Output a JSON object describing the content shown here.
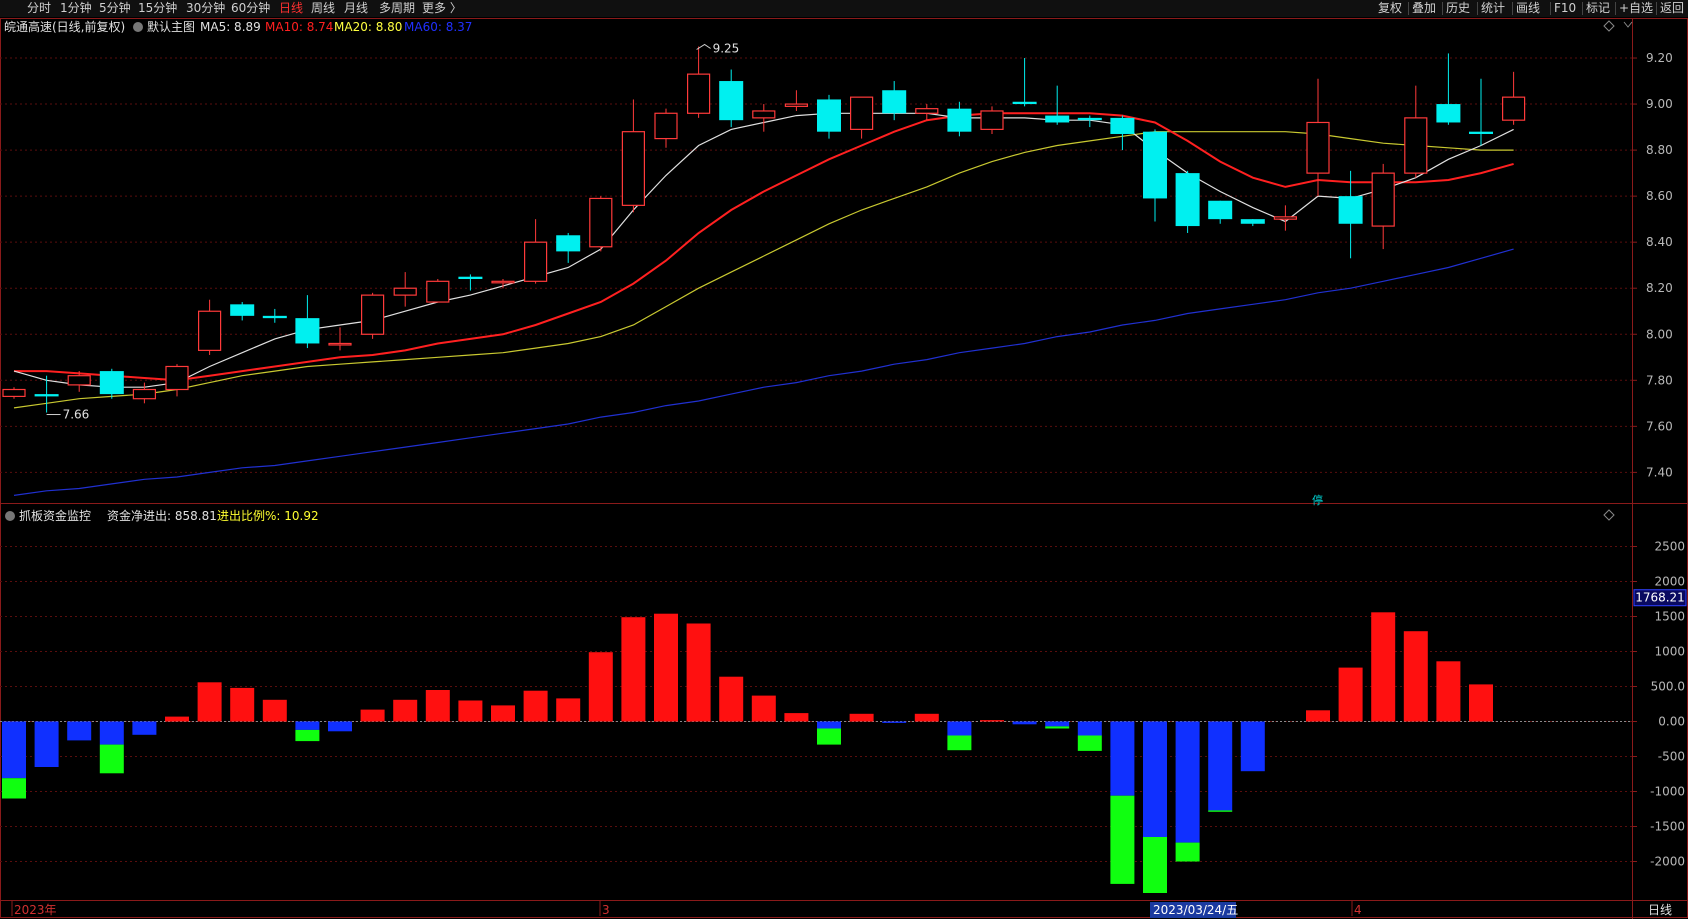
{
  "toolbar": {
    "periods": [
      "分时",
      "1分钟",
      "5分钟",
      "15分钟",
      "30分钟",
      "60分钟",
      "日线",
      "周线",
      "月线",
      "多周期",
      "更多 〉"
    ],
    "active_period": "日线",
    "actions": [
      "复权",
      "叠加",
      "历史",
      "统计",
      "画线",
      "F10",
      "标记",
      "+自选",
      "返回"
    ]
  },
  "main_panel": {
    "stock_title": "皖通高速(日线,前复权)",
    "template_label": "默认主图",
    "ma_labels": [
      {
        "text": "MA5: 8.89",
        "color": "#e0e0e0"
      },
      {
        "text": "MA10: 8.74",
        "color": "#ff2020"
      },
      {
        "text": "MA20: 8.80",
        "color": "#ffff40"
      },
      {
        "text": "MA60: 8.37",
        "color": "#2030ff"
      }
    ],
    "high_marker": "9.25",
    "low_marker": "7.66",
    "side_marker": "停"
  },
  "sub_panel": {
    "indicator_name": "抓板资金监控",
    "net_flow_label": "资金净进出: 858.81",
    "ratio_label": "进出比例%: 10.92",
    "current_value_tag": "1768.21"
  },
  "axis": {
    "dates": [
      "2023年",
      "3",
      "2023/03/24/五",
      "4"
    ],
    "period_label": "日线"
  },
  "chart_data": [
    {
      "type": "candlestick",
      "title": "皖通高速(日线,前复权)",
      "y_ticks": [
        "9.20",
        "9.00",
        "8.80",
        "8.60",
        "8.40",
        "8.20",
        "8.00",
        "7.80",
        "7.60",
        "7.40"
      ],
      "ylim": [
        7.28,
        9.3
      ],
      "candles": [
        {
          "o": 7.73,
          "c": 7.76,
          "h": 7.77,
          "l": 7.72
        },
        {
          "o": 7.74,
          "c": 7.73,
          "h": 7.82,
          "l": 7.66
        },
        {
          "o": 7.78,
          "c": 7.82,
          "h": 7.84,
          "l": 7.75
        },
        {
          "o": 7.84,
          "c": 7.74,
          "h": 7.85,
          "l": 7.72
        },
        {
          "o": 7.72,
          "c": 7.76,
          "h": 7.79,
          "l": 7.7
        },
        {
          "o": 7.76,
          "c": 7.86,
          "h": 7.87,
          "l": 7.73
        },
        {
          "o": 7.93,
          "c": 8.1,
          "h": 8.15,
          "l": 7.91
        },
        {
          "o": 8.13,
          "c": 8.08,
          "h": 8.14,
          "l": 8.06
        },
        {
          "o": 8.08,
          "c": 8.07,
          "h": 8.11,
          "l": 8.05
        },
        {
          "o": 8.07,
          "c": 7.96,
          "h": 8.17,
          "l": 7.94
        },
        {
          "o": 7.96,
          "c": 7.96,
          "h": 8.03,
          "l": 7.93
        },
        {
          "o": 8.0,
          "c": 8.17,
          "h": 8.18,
          "l": 7.98
        },
        {
          "o": 8.17,
          "c": 8.2,
          "h": 8.27,
          "l": 8.12
        },
        {
          "o": 8.14,
          "c": 8.23,
          "h": 8.24,
          "l": 8.14
        },
        {
          "o": 8.25,
          "c": 8.24,
          "h": 8.26,
          "l": 8.19
        },
        {
          "o": 8.23,
          "c": 8.23,
          "h": 8.24,
          "l": 8.2
        },
        {
          "o": 8.23,
          "c": 8.4,
          "h": 8.5,
          "l": 8.22
        },
        {
          "o": 8.43,
          "c": 8.36,
          "h": 8.44,
          "l": 8.31
        },
        {
          "o": 8.38,
          "c": 8.59,
          "h": 8.6,
          "l": 8.36
        },
        {
          "o": 8.56,
          "c": 8.88,
          "h": 9.02,
          "l": 8.53
        },
        {
          "o": 8.85,
          "c": 8.96,
          "h": 8.98,
          "l": 8.81
        },
        {
          "o": 8.96,
          "c": 9.13,
          "h": 9.25,
          "l": 8.94
        },
        {
          "o": 9.1,
          "c": 8.93,
          "h": 9.15,
          "l": 8.9
        },
        {
          "o": 8.94,
          "c": 8.97,
          "h": 9.0,
          "l": 8.88
        },
        {
          "o": 8.99,
          "c": 9.0,
          "h": 9.06,
          "l": 8.97
        },
        {
          "o": 9.02,
          "c": 8.88,
          "h": 9.04,
          "l": 8.85
        },
        {
          "o": 8.89,
          "c": 9.03,
          "h": 9.03,
          "l": 8.85
        },
        {
          "o": 9.06,
          "c": 8.96,
          "h": 9.1,
          "l": 8.93
        },
        {
          "o": 8.96,
          "c": 8.98,
          "h": 9.0,
          "l": 8.93
        },
        {
          "o": 8.98,
          "c": 8.88,
          "h": 9.01,
          "l": 8.86
        },
        {
          "o": 8.89,
          "c": 8.97,
          "h": 8.99,
          "l": 8.87
        },
        {
          "o": 9.01,
          "c": 9.0,
          "h": 9.2,
          "l": 8.99
        },
        {
          "o": 8.95,
          "c": 8.92,
          "h": 9.08,
          "l": 8.91
        },
        {
          "o": 8.94,
          "c": 8.93,
          "h": 8.95,
          "l": 8.9
        },
        {
          "o": 8.94,
          "c": 8.87,
          "h": 8.95,
          "l": 8.8
        },
        {
          "o": 8.88,
          "c": 8.59,
          "h": 8.89,
          "l": 8.49
        },
        {
          "o": 8.7,
          "c": 8.47,
          "h": 8.71,
          "l": 8.44
        },
        {
          "o": 8.58,
          "c": 8.5,
          "h": 8.58,
          "l": 8.48
        },
        {
          "o": 8.5,
          "c": 8.48,
          "h": 8.5,
          "l": 8.47
        },
        {
          "o": 8.5,
          "c": 8.51,
          "h": 8.56,
          "l": 8.45
        },
        {
          "o": 8.7,
          "c": 8.92,
          "h": 9.11,
          "l": 8.6
        },
        {
          "o": 8.6,
          "c": 8.48,
          "h": 8.71,
          "l": 8.33
        },
        {
          "o": 8.47,
          "c": 8.7,
          "h": 8.74,
          "l": 8.37
        },
        {
          "o": 8.7,
          "c": 8.94,
          "h": 9.08,
          "l": 8.68
        },
        {
          "o": 9.0,
          "c": 8.92,
          "h": 9.22,
          "l": 8.91
        },
        {
          "o": 8.88,
          "c": 8.87,
          "h": 9.11,
          "l": 8.82
        },
        {
          "o": 8.93,
          "c": 9.03,
          "h": 9.14,
          "l": 8.91
        }
      ],
      "ma5": [
        7.84,
        7.8,
        7.78,
        7.77,
        7.77,
        7.79,
        7.86,
        7.92,
        7.98,
        8.02,
        8.04,
        8.06,
        8.1,
        8.14,
        8.17,
        8.21,
        8.25,
        8.29,
        8.37,
        8.54,
        8.69,
        8.82,
        8.89,
        8.92,
        8.95,
        8.96,
        8.96,
        8.96,
        8.96,
        8.94,
        8.94,
        8.94,
        8.93,
        8.93,
        8.91,
        8.8,
        8.7,
        8.62,
        8.55,
        8.49,
        8.6,
        8.59,
        8.63,
        8.68,
        8.76,
        8.82,
        8.89
      ],
      "ma10": [
        7.84,
        7.84,
        7.83,
        7.82,
        7.81,
        7.8,
        7.82,
        7.84,
        7.86,
        7.88,
        7.9,
        7.91,
        7.93,
        7.96,
        7.98,
        8.0,
        8.04,
        8.09,
        8.14,
        8.22,
        8.32,
        8.44,
        8.54,
        8.62,
        8.69,
        8.76,
        8.82,
        8.88,
        8.93,
        8.95,
        8.96,
        8.96,
        8.96,
        8.96,
        8.95,
        8.92,
        8.84,
        8.75,
        8.68,
        8.64,
        8.67,
        8.66,
        8.66,
        8.66,
        8.67,
        8.7,
        8.74
      ],
      "ma20": [
        7.68,
        7.7,
        7.72,
        7.73,
        7.74,
        7.76,
        7.79,
        7.82,
        7.84,
        7.86,
        7.87,
        7.88,
        7.89,
        7.9,
        7.91,
        7.92,
        7.94,
        7.96,
        7.99,
        8.04,
        8.12,
        8.2,
        8.27,
        8.34,
        8.41,
        8.48,
        8.54,
        8.59,
        8.64,
        8.7,
        8.75,
        8.79,
        8.82,
        8.84,
        8.86,
        8.88,
        8.88,
        8.88,
        8.88,
        8.88,
        8.87,
        8.85,
        8.83,
        8.82,
        8.81,
        8.8,
        8.8
      ],
      "ma60": [
        7.3,
        7.32,
        7.33,
        7.35,
        7.37,
        7.38,
        7.4,
        7.42,
        7.43,
        7.45,
        7.47,
        7.49,
        7.51,
        7.53,
        7.55,
        7.57,
        7.59,
        7.61,
        7.64,
        7.66,
        7.69,
        7.71,
        7.74,
        7.77,
        7.79,
        7.82,
        7.84,
        7.87,
        7.89,
        7.92,
        7.94,
        7.96,
        7.99,
        8.01,
        8.04,
        8.06,
        8.09,
        8.11,
        8.13,
        8.15,
        8.18,
        8.2,
        8.23,
        8.26,
        8.29,
        8.33,
        8.37
      ]
    },
    {
      "type": "bar",
      "title": "抓板资金监控",
      "y_ticks": [
        "2500",
        "2000",
        "1500",
        "1000",
        "500.0",
        "0.00",
        "-500",
        "-1000",
        "-1500",
        "-2000"
      ],
      "ylim": [
        -2550,
        2950
      ],
      "series": [
        {
          "values": [
            -1100,
            -650,
            -270,
            -740,
            -190,
            70,
            560,
            480,
            310,
            -280,
            -140,
            170,
            310,
            450,
            300,
            230,
            440,
            330,
            990,
            1490,
            1540,
            1400,
            640,
            370,
            120,
            -330,
            110,
            -20,
            110,
            -410,
            20,
            -40,
            -100,
            -420,
            -2320,
            -2450,
            -2000,
            -1290,
            -710,
            0,
            160,
            770,
            1560,
            1290,
            860,
            530
          ],
          "fills": [
            "g",
            "b",
            "b",
            "g",
            "b",
            "y",
            "y",
            "r",
            "r",
            "g",
            "b",
            "y",
            "y",
            "y",
            "r",
            "r",
            "y",
            "r",
            "y",
            "y",
            "y",
            "y",
            "r",
            "y",
            "r",
            "g",
            "y",
            "g",
            "y",
            "g",
            "y",
            "g",
            "g",
            "g",
            "g",
            "g",
            "g",
            "g",
            "b",
            "y",
            "r",
            "y",
            "y",
            "r",
            "r",
            "y"
          ],
          "splits": [
            -810,
            -650,
            -270,
            -330,
            -190,
            70,
            560,
            480,
            310,
            -120,
            -140,
            170,
            310,
            450,
            300,
            230,
            440,
            330,
            990,
            1490,
            1540,
            1400,
            640,
            370,
            120,
            -100,
            110,
            -20,
            110,
            -200,
            20,
            -40,
            -70,
            -200,
            -1060,
            -1650,
            -1730,
            -1270,
            -710,
            0,
            160,
            770,
            1560,
            1290,
            860,
            530
          ]
        }
      ]
    }
  ]
}
